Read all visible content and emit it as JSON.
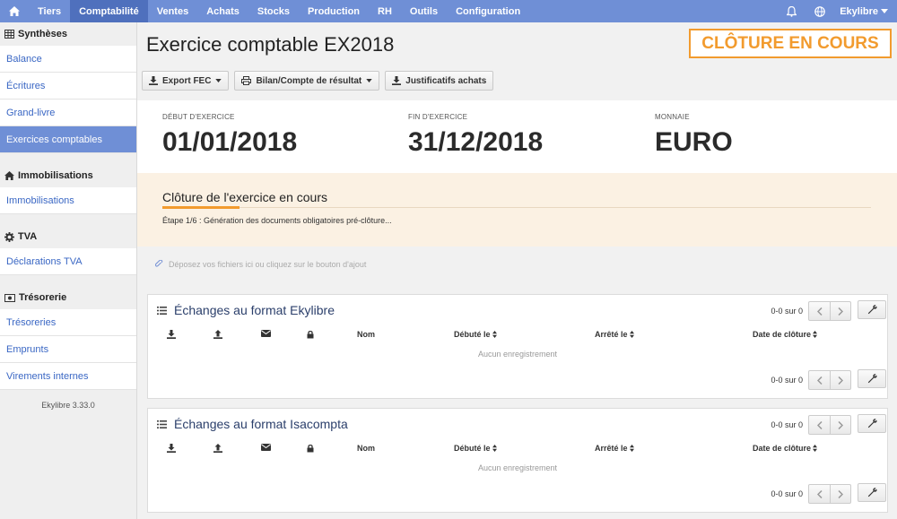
{
  "topnav": {
    "items": [
      {
        "label": "Tiers",
        "active": false
      },
      {
        "label": "Comptabilité",
        "active": true
      },
      {
        "label": "Ventes",
        "active": false
      },
      {
        "label": "Achats",
        "active": false
      },
      {
        "label": "Stocks",
        "active": false
      },
      {
        "label": "Production",
        "active": false
      },
      {
        "label": "RH",
        "active": false
      },
      {
        "label": "Outils",
        "active": false
      },
      {
        "label": "Configuration",
        "active": false
      }
    ],
    "user": "Ekylibre",
    "icons": [
      "home-icon",
      "bell-icon",
      "globe-icon",
      "caret-down-icon"
    ]
  },
  "sidebar": {
    "sections": [
      {
        "title": "Synthèses",
        "icon": "table-icon",
        "items": [
          "Balance",
          "Écritures",
          "Grand-livre",
          "Exercices comptables"
        ]
      },
      {
        "title": "Immobilisations",
        "icon": "home-icon",
        "items": [
          "Immobilisations"
        ]
      },
      {
        "title": "TVA",
        "icon": "gear-icon",
        "items": [
          "Déclarations TVA"
        ]
      },
      {
        "title": "Trésorerie",
        "icon": "money-icon",
        "items": [
          "Trésoreries",
          "Emprunts",
          "Virements internes"
        ]
      }
    ],
    "active_item": "Exercices comptables",
    "version": "Ekylibre 3.33.0"
  },
  "page": {
    "title": "Exercice comptable EX2018",
    "status": "CLÔTURE EN COURS",
    "status_color": "#f29b2e"
  },
  "toolbar": {
    "export": "Export FEC",
    "bilan": "Bilan/Compte de résultat",
    "justif": "Justificatifs achats"
  },
  "info": {
    "start_label": "DÉBUT D'EXERCICE",
    "start_value": "01/01/2018",
    "end_label": "FIN D'EXERCICE",
    "end_value": "31/12/2018",
    "currency_label": "MONNAIE",
    "currency_value": "EURO"
  },
  "closing": {
    "title": "Clôture de l'exercice en cours",
    "step": "Étape 1/6 : Génération des documents obligatoires pré-clôture...",
    "progress": 0.1667
  },
  "dropzone": {
    "text": "Déposez vos fichiers ici ou cliquez sur le bouton d'ajout"
  },
  "panels": [
    {
      "title": "Échanges au format Ekylibre",
      "pager": "0-0 sur 0",
      "columns": {
        "name": "Nom",
        "started": "Débuté le",
        "stopped": "Arrêté le",
        "closed": "Date de clôture"
      },
      "empty": "Aucun enregistrement"
    },
    {
      "title": "Échanges au format Isacompta",
      "pager": "0-0 sur 0",
      "columns": {
        "name": "Nom",
        "started": "Débuté le",
        "stopped": "Arrêté le",
        "closed": "Date de clôture"
      },
      "empty": "Aucun enregistrement"
    }
  ],
  "colors": {
    "nav": "#6f8fd6",
    "nav_active": "#4f70bd",
    "accent": "#f29b2e",
    "link": "#3a67c4"
  }
}
